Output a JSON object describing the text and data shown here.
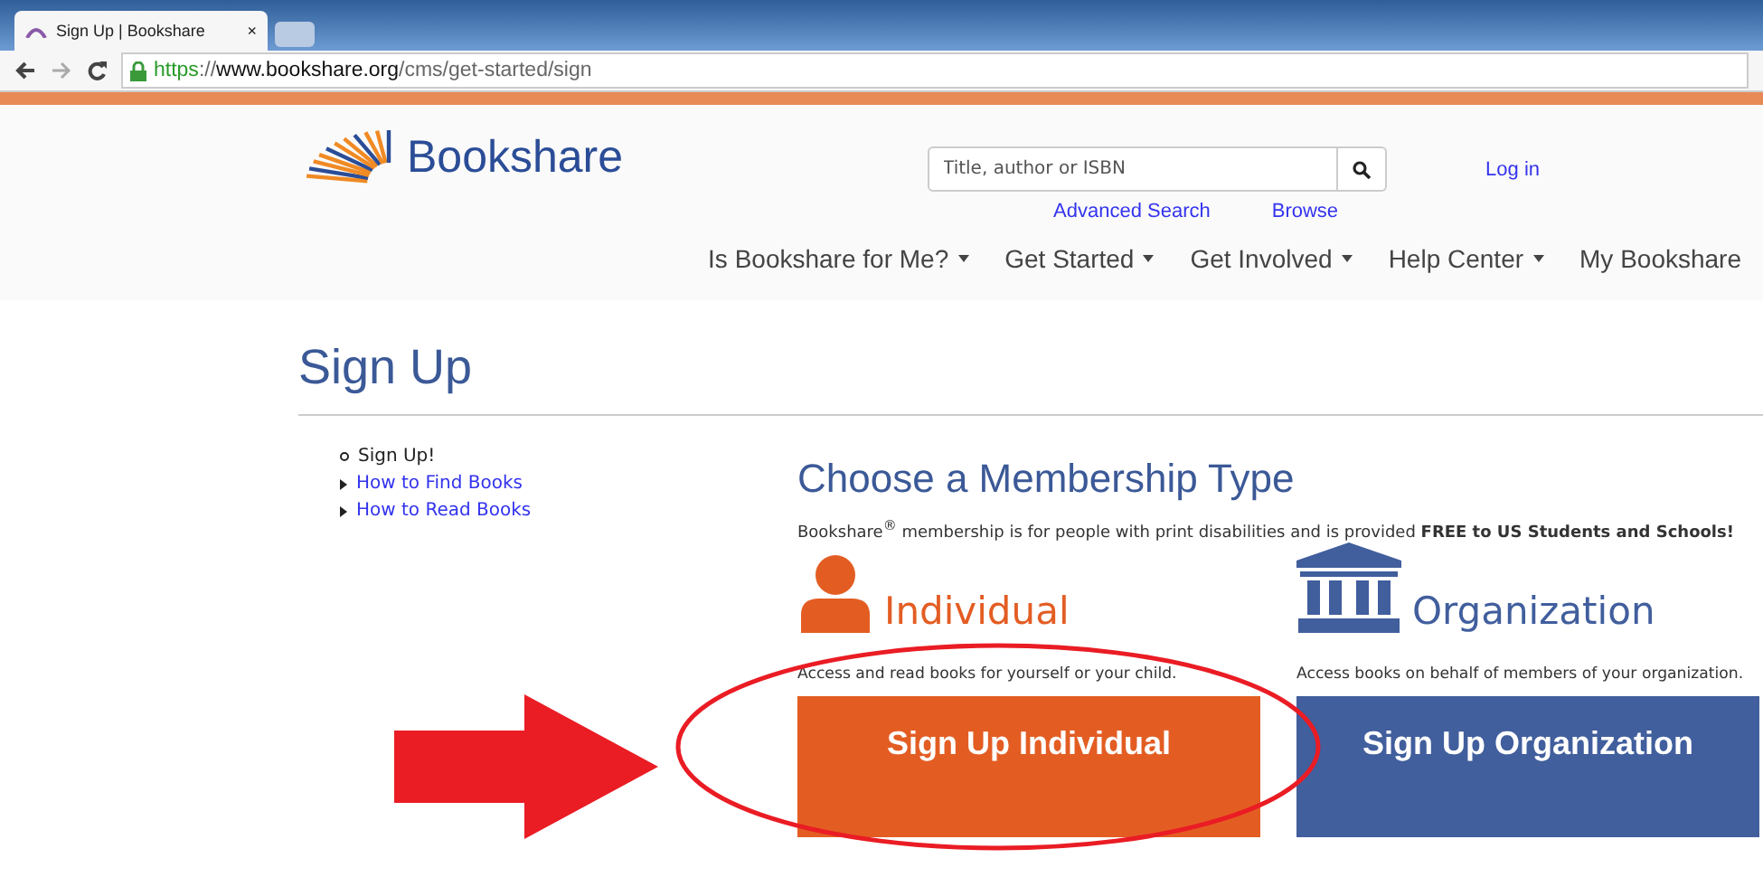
{
  "browser": {
    "tab_title": "Sign Up | Bookshare",
    "tab_close": "×",
    "url_scheme": "https",
    "url_rest": "://",
    "url_host": "www.bookshare.org",
    "url_path": "/cms/get-started/sign"
  },
  "header": {
    "logo": "Bookshare",
    "search": {
      "placeholder": "Title, author or ISBN"
    },
    "search_links": [
      "Advanced Search",
      "Browse"
    ],
    "login": "Log in",
    "nav": [
      {
        "label": "Is Bookshare for Me?",
        "dropdown": true
      },
      {
        "label": "Get Started",
        "dropdown": true
      },
      {
        "label": "Get Involved",
        "dropdown": true
      },
      {
        "label": "Help Center",
        "dropdown": true
      },
      {
        "label": "My Bookshare",
        "dropdown": false
      }
    ]
  },
  "page_title": "Sign Up",
  "sidebar": [
    {
      "label": "Sign Up!",
      "selected": true
    },
    {
      "label": "How to Find Books",
      "selected": false
    },
    {
      "label": "How to Read Books",
      "selected": false
    }
  ],
  "membership": {
    "title": "Choose a Membership Type",
    "intro": "Bookshare$^{®}$ membership is for people with print disabilities and is provided **FREE to US Students and Schools!**",
    "types": [
      {
        "kind": "individual",
        "name": "Individual",
        "description": "Access and read books for yourself or your child.",
        "button": "Sign Up Individual",
        "color": "#e35d23"
      },
      {
        "kind": "organization",
        "name": "Organization",
        "description": "Access books on behalf of members of your organization.",
        "button": "Sign Up Organization",
        "color": "#415e9d"
      }
    ]
  }
}
